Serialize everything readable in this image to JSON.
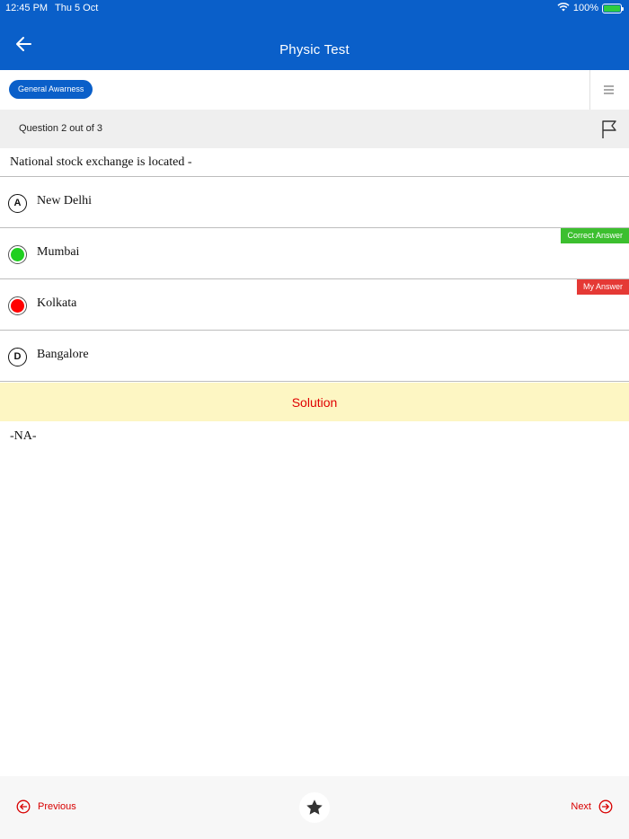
{
  "status_bar": {
    "time": "12:45 PM",
    "date": "Thu 5 Oct",
    "battery_text": "100%",
    "battery_level": 1.0
  },
  "header": {
    "title": "Physic Test",
    "back_icon": "arrow-left-icon",
    "background_color": "#0a5fc9"
  },
  "subject": {
    "chip_label": "General Awarness",
    "menu_icon": "hamburger-menu-icon"
  },
  "question_info": {
    "progress_text": "Question 2 out of 3",
    "flag_icon": "flag-icon"
  },
  "question": {
    "text": "National stock exchange is located -"
  },
  "options": [
    {
      "letter": "A",
      "text": "New Delhi",
      "state": "normal",
      "tag": ""
    },
    {
      "letter": "B",
      "text": "Mumbai",
      "state": "correct",
      "tag": "Correct Answer"
    },
    {
      "letter": "C",
      "text": "Kolkata",
      "state": "wrong",
      "tag": "My Answer"
    },
    {
      "letter": "D",
      "text": "Bangalore",
      "state": "normal",
      "tag": ""
    }
  ],
  "solution": {
    "title": "Solution",
    "text": "-NA-"
  },
  "footer": {
    "previous_label": "Previous",
    "next_label": "Next",
    "bookmark_icon": "star-icon"
  },
  "colors": {
    "primary": "#0a5fc9",
    "correct": "#1fcf1f",
    "wrong": "#ff0000",
    "correct_tag": "#3cbf2f",
    "my_answer_tag": "#e53935",
    "solution_bg": "#fdf6c3",
    "accent_red": "#d80000"
  }
}
